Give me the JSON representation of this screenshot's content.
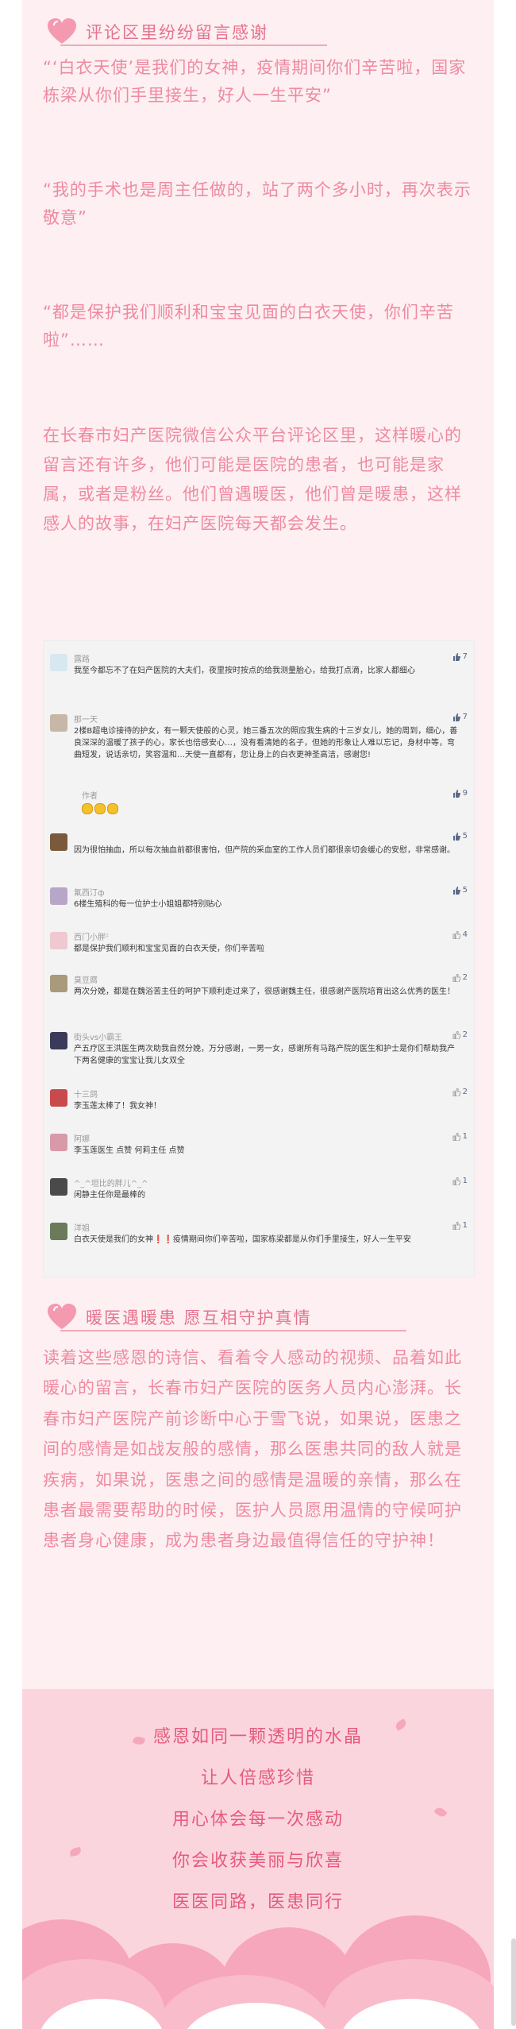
{
  "section1": {
    "title": "评论区里纷纷留言感谢",
    "quote1": "“‘白衣天使’是我们的女神，疫情期间你们辛苦啦，国家栋梁从你们手里接生，好人一生平安”",
    "quote2": "“我的手术也是周主任做的，站了两个多小时，再次表示敬意”",
    "quote3": "“都是保护我们顺利和宝宝见面的白衣天使，你们辛苦啦”……",
    "paragraph": "在长春市妇产医院微信公众平台评论区里，这样暖心的留言还有许多，他们可能是医院的患者，也可能是家属，或者是粉丝。他们曾遇暖医，他们曾是暖患，这样感人的故事，在妇产医院每天都会发生。"
  },
  "comments": [
    {
      "name": "露路",
      "text": "我至今都忘不了在妇产医院的大夫们，夜里按时按点的给我测量胎心，给我打点滴，比家人都细心",
      "likes": "7",
      "liked": true
    },
    {
      "name": "那一天",
      "text": "2楼B超电诊接待的护女，有一颗天使般的心灵，她三番五次的照应我生病的十三岁女儿，她的周到，细心，善良深深的温暖了孩子的心，家长也倍感安心…，没有看清她的名子，但她的形象让人难以忘记，身材中等，弯曲短发，说话亲切，笑容温和…天使一直都有，您让身上的白衣更神圣高洁，感谢您!",
      "likes": "7",
      "liked": true
    },
    {
      "name": "作者",
      "text": "",
      "likes": "9",
      "liked": true
    },
    {
      "name": "",
      "text": "因为很怕抽血，所以每次抽血前都很害怕，但产院的采血室的工作人员们都很亲切会缓心的安慰，非常感谢。",
      "likes": "5",
      "liked": true
    },
    {
      "name": "氟西汀ф",
      "text": "6楼生殖科的每一位护士小姐姐都特别贴心",
      "likes": "5",
      "liked": true
    },
    {
      "name": "西门小胖ᵕ̈",
      "text": "都是保护我们顺利和宝宝见面的白衣天使，你们辛苦啦",
      "likes": "4",
      "liked": false
    },
    {
      "name": "臭豆腐",
      "text": "两次分娩，都是在魏浴苦主任的呵护下顺利走过来了，很感谢魏主任，很感谢产医院培育出这么优秀的医生！",
      "likes": "2",
      "liked": false
    },
    {
      "name": "街头vs小霸王",
      "text": "产五疗区王洪医生两次助我自然分娩，万分感谢，一男一女，感谢所有马路产院的医生和护士是你们帮助我产下两名健康的宝宝让我儿女双全",
      "likes": "2",
      "liked": false
    },
    {
      "name": "十三鸽",
      "text": "李玉莲太棒了！我女神！",
      "likes": "2",
      "liked": false
    },
    {
      "name": "阿娜",
      "text": "李玉莲医生 点赞 何莉主任 点赞",
      "likes": "1",
      "liked": false
    },
    {
      "name": "^_^坦比的胖儿^_^",
      "text": "闲静主任你是最棒的",
      "likes": "1",
      "liked": false
    },
    {
      "name": "洋姐",
      "text": "白衣天使是我们的女神❗️❗️疫情期间你们辛苦啦，国家栋梁都是从你们手里接生，好人一生平安",
      "likes": "1",
      "liked": false
    }
  ],
  "section2": {
    "title": "暖医遇暖患 愿互相守护真情",
    "paragraph": "读着这些感恩的诗信、看着令人感动的视频、品着如此暖心的留言，长春市妇产医院的医务人员内心澎湃。长春市妇产医院产前诊断中心于雪飞说，如果说，医患之间的感情是如战友般的感情，那么医患共同的敌人就是疾病，如果说，医患之间的感情是温暖的亲情，那么在患者最需要帮助的时候，医护人员愿用温情的守候呵护患者身心健康，成为患者身边最值得信任的守护神！"
  },
  "poem": [
    "感恩如同一颗透明的水晶",
    "让人倍感珍惜",
    "用心体会每一次感动",
    "你会收获美丽与欣喜",
    "医医同路，医患同行"
  ],
  "colors": {
    "accent": "#e5738d",
    "text_pink": "#ef8aa0",
    "poem": "#e55b7d",
    "background": "#fdeff2"
  }
}
